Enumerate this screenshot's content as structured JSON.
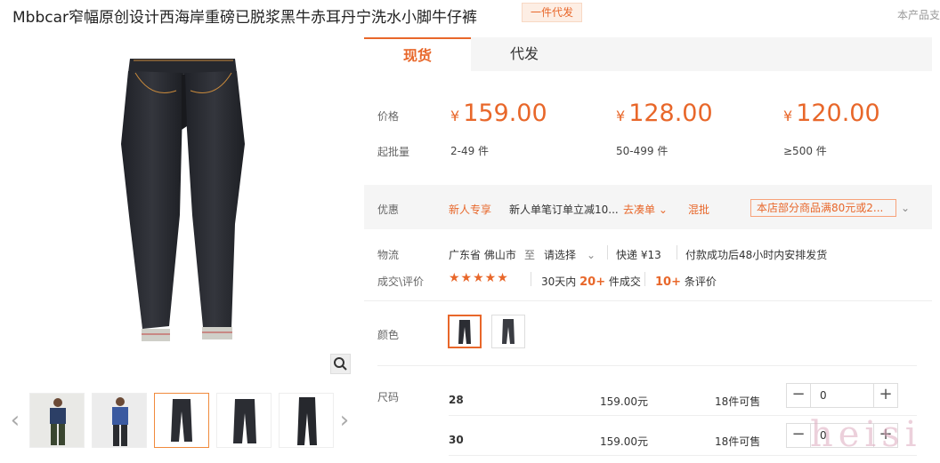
{
  "title": "Mbbcar窄幅原创设计西海岸重磅已脱浆黑牛赤耳丹宁洗水小脚牛仔裤",
  "dropship_tag": "一件代发",
  "top_right": "本产品支",
  "tabs": [
    "现货",
    "代发"
  ],
  "labels": {
    "price": "价格",
    "moq": "起批量",
    "promo": "优惠",
    "logistics": "物流",
    "trade": "成交\\评价",
    "color": "颜色",
    "size": "尺码"
  },
  "currency": "¥",
  "price_tiers": [
    {
      "price": "159.00",
      "range": "2-49 件"
    },
    {
      "price": "128.00",
      "range": "50-499 件"
    },
    {
      "price": "120.00",
      "range": "≥500 件"
    }
  ],
  "promo": {
    "new_user": "新人专享",
    "new_user_desc": "新人单笔订单立减10...",
    "go_bundle": "去凑单",
    "mix": "混批",
    "store_offer": "本店部分商品满80元或2..."
  },
  "logistics": {
    "origin": "广东省 佛山市",
    "to": "至",
    "dest": "请选择",
    "express": "快递 ¥13",
    "ship_note": "付款成功后48小时内安排发货"
  },
  "trade": {
    "stars": "★★★★★",
    "days_prefix": "30天内",
    "count": "20+",
    "count_suffix": "件成交",
    "reviews": "10+",
    "reviews_suffix": "条评价"
  },
  "sizes": [
    {
      "size": "28",
      "price": "159.00元",
      "stock": "18件可售",
      "qty": "0"
    },
    {
      "size": "30",
      "price": "159.00元",
      "stock": "18件可售",
      "qty": "0"
    }
  ],
  "watermark": "heisi",
  "colors": {
    "accent": "#e8672a",
    "denim": "#2b2d33"
  }
}
